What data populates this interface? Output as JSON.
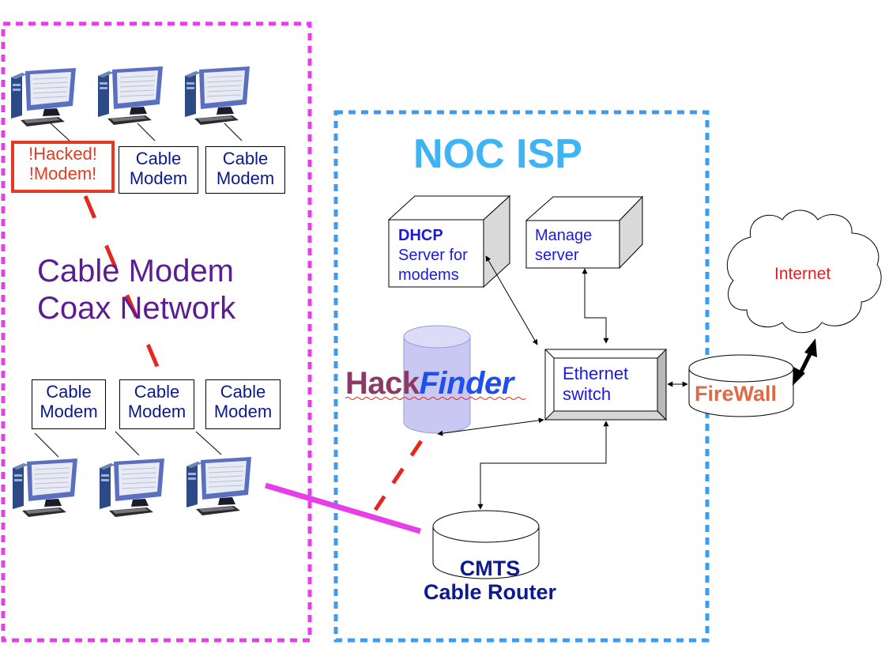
{
  "diagram": {
    "left_zone": {
      "title_line1": "Cable Modem",
      "title_line2": "Coax Network",
      "border_color": "#e63ee8"
    },
    "top_modems": [
      {
        "line1": "!Hacked!",
        "line2": "!Modem!",
        "hacked": true
      },
      {
        "line1": "Cable",
        "line2": "Modem",
        "hacked": false
      },
      {
        "line1": "Cable",
        "line2": "Modem",
        "hacked": false
      }
    ],
    "bottom_modems": [
      {
        "line1": "Cable",
        "line2": "Modem"
      },
      {
        "line1": "Cable",
        "line2": "Modem"
      },
      {
        "line1": "Cable",
        "line2": "Modem"
      }
    ],
    "noc_zone": {
      "title": "NOC ISP",
      "border_color": "#3d9cf0",
      "title_color": "#3fb4f5"
    },
    "dhcp_server": {
      "line1": "DHCP",
      "line2": "Server for",
      "line3": "modems"
    },
    "manage_server": {
      "line1": "Manage",
      "line2": "server"
    },
    "ethernet_switch": {
      "line1": "Ethernet",
      "line2": "switch"
    },
    "hackfinder": {
      "part1": "Hack",
      "part2": "Finder",
      "color1": "#8b3a66",
      "color2": "#1f4ff0"
    },
    "firewall": {
      "label": "FireWall",
      "color": "#e06a45"
    },
    "internet": {
      "label": "Internet",
      "color": "#e02020"
    },
    "cmts": {
      "line1": "CMTS",
      "line2": "Cable Router",
      "color": "#0d1a8f"
    },
    "colors": {
      "hack_line": "#e8261f",
      "coax_line": "#e63ee8",
      "blue_text": "#1a1adf"
    }
  }
}
